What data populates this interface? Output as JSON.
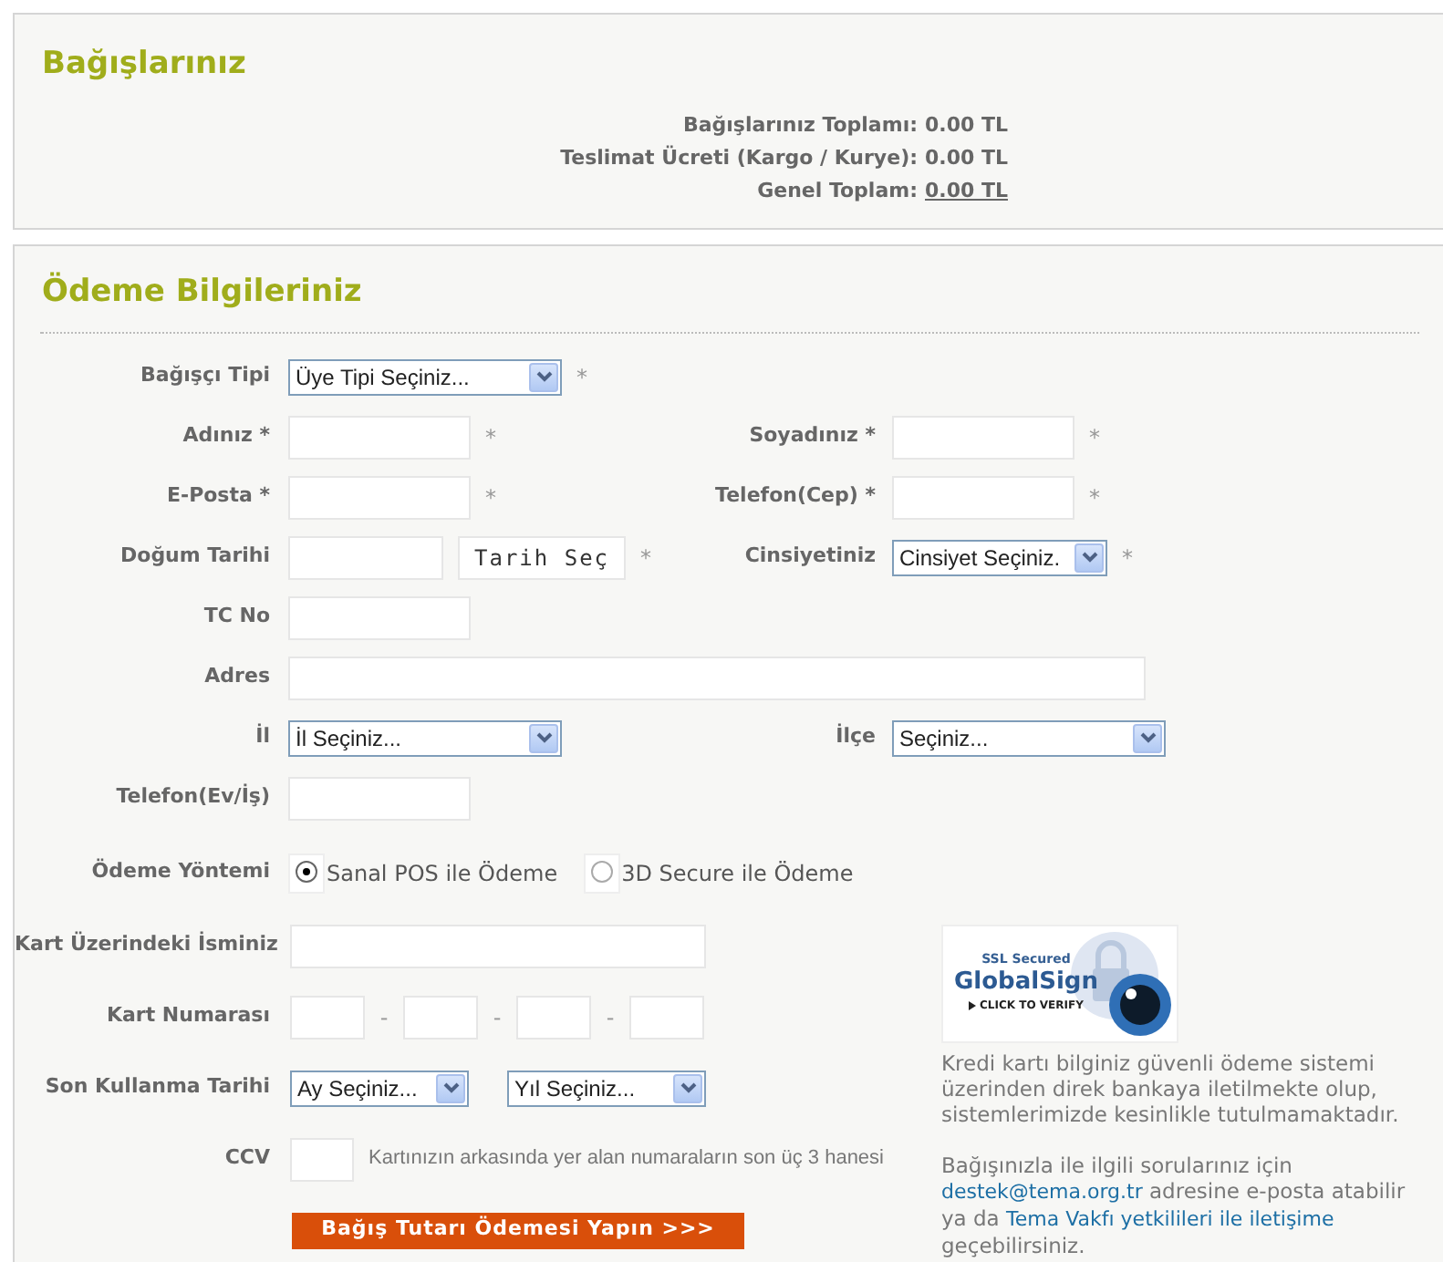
{
  "summary": {
    "title": "Bağışlarınız",
    "lines": [
      {
        "label": "Bağışlarınız Toplamı:",
        "value": "0.00 TL",
        "underlined": false
      },
      {
        "label": "Teslimat Ücreti (Kargo / Kurye):",
        "value": "0.00 TL",
        "underlined": false
      },
      {
        "label": "Genel Toplam:",
        "value": "0.00 TL",
        "underlined": true
      }
    ]
  },
  "payment": {
    "title": "Ödeme Bilgileriniz",
    "rows": [
      {
        "left": {
          "label": "Bağışçı Tipi",
          "kind": "select",
          "value": "Üye Tipi Seçiniz...",
          "mark": "*"
        }
      },
      {
        "left": {
          "label": "Adınız *",
          "kind": "input",
          "mark": "*"
        },
        "right": {
          "label": "Soyadınız *",
          "kind": "input",
          "mark": "*"
        }
      },
      {
        "left": {
          "label": "E-Posta *",
          "kind": "input",
          "mark": "*"
        },
        "right": {
          "label": "Telefon(Cep) *",
          "kind": "input",
          "mark": "*"
        }
      },
      {
        "left": {
          "label": "Doğum Tarihi",
          "kind": "date",
          "button": "Tarih Seç",
          "mark": "*"
        },
        "right": {
          "label": "Cinsiyetiniz",
          "kind": "compact-select",
          "value": "Cinsiyet Seçiniz.",
          "mark": "*"
        }
      },
      {
        "left": {
          "label": "TC No",
          "kind": "input"
        }
      },
      {
        "left": {
          "label": "Adres",
          "kind": "wide-input"
        }
      },
      {
        "left": {
          "label": "İl",
          "kind": "select",
          "value": "İl Seçiniz..."
        },
        "right": {
          "label": "İlçe",
          "kind": "select",
          "value": "Seçiniz..."
        }
      },
      {
        "left": {
          "label": "Telefon(Ev/İş)",
          "kind": "input"
        }
      },
      {
        "left": {
          "label": "Ödeme Yöntemi",
          "kind": "radio",
          "options": [
            {
              "label": "Sanal POS ile Ödeme",
              "selected": true
            },
            {
              "label": "3D Secure ile Ödeme",
              "selected": false
            }
          ]
        }
      }
    ],
    "card_rows": [
      {
        "label": "Kart Üzerindeki İsminiz",
        "kind": "long-input"
      },
      {
        "label": "Kart Numarası",
        "kind": "card-number",
        "separators": [
          "-",
          "-",
          "-"
        ]
      },
      {
        "label": "Son Kullanma Tarihi",
        "kind": "expiry",
        "options": [
          "Ay Seçiniz...",
          "Yıl Seçiniz..."
        ]
      },
      {
        "label": "CCV",
        "kind": "ccv",
        "hint": "Kartınızın arkasında yer alan numaraların son üç 3 hanesi"
      }
    ],
    "submit": "Bağış Tutarı Ödemesi Yapın >>>",
    "security": {
      "badge": {
        "top": "SSL Secured",
        "name": "GlobalSign",
        "action": "CLICK TO VERIFY"
      },
      "note": "Kredi kartı bilginiz güvenli ödeme sistemi üzerinden direk bankaya iletilmekte olup, sistemlerimizde kesinlikle tutulmamaktadır.",
      "contact": [
        {
          "text": "Bağışınızla ile ilgili sorularınız için ",
          "link": false
        },
        {
          "text": "destek@tema.org.tr",
          "link": true
        },
        {
          "text": " adresine e-posta atabilir ya da ",
          "link": false
        },
        {
          "text": "Tema Vakfı yetkilileri ile iletişime",
          "link": true
        },
        {
          "text": " geçebilirsiniz.",
          "link": false
        }
      ]
    }
  }
}
